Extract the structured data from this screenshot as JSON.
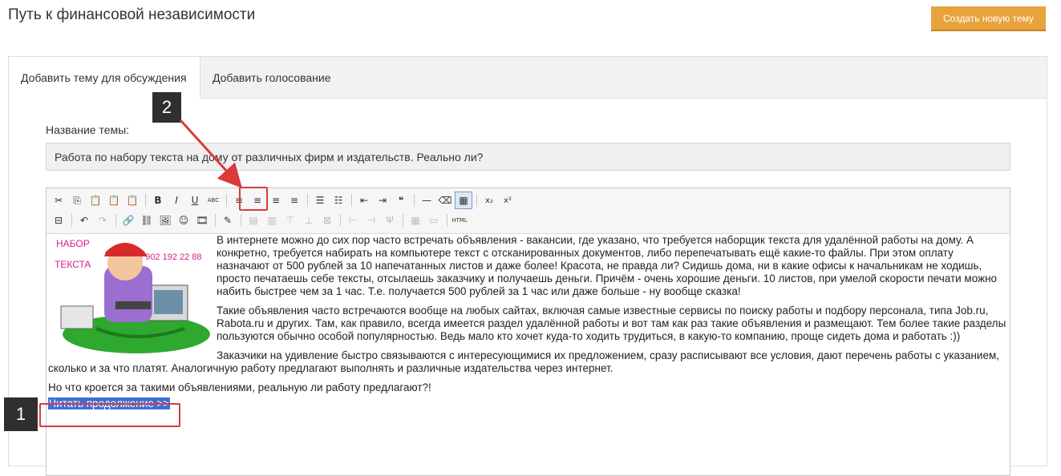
{
  "header": {
    "title": "Путь к финансовой независимости",
    "create_button": "Создать новую тему"
  },
  "tabs": [
    {
      "label": "Добавить тему для обсуждения",
      "active": true
    },
    {
      "label": "Добавить голосование",
      "active": false
    }
  ],
  "form": {
    "title_label": "Название темы:",
    "title_value": "Работа по набору текста на дому от различных фирм и издательств. Реально ли?"
  },
  "toolbar": {
    "row1": [
      {
        "icon": "cut-icon",
        "glyph": "✂"
      },
      {
        "icon": "copy-icon",
        "glyph": "⎘"
      },
      {
        "icon": "paste-icon",
        "glyph": "📋"
      },
      {
        "icon": "paste-text-icon",
        "glyph": "📋"
      },
      {
        "icon": "paste-word-icon",
        "glyph": "📋"
      },
      {
        "sep": true
      },
      {
        "icon": "bold-icon",
        "glyph": "B"
      },
      {
        "icon": "italic-icon",
        "glyph": "I"
      },
      {
        "icon": "underline-icon",
        "glyph": "U"
      },
      {
        "icon": "strikethrough-icon",
        "glyph": "ABC"
      },
      {
        "sep": true
      },
      {
        "icon": "align-left-icon",
        "glyph": "≡"
      },
      {
        "icon": "align-center-icon",
        "glyph": "≡"
      },
      {
        "icon": "align-right-icon",
        "glyph": "≡"
      },
      {
        "icon": "align-justify-icon",
        "glyph": "≡"
      },
      {
        "sep": true
      },
      {
        "icon": "bullet-list-icon",
        "glyph": "☰"
      },
      {
        "icon": "numbered-list-icon",
        "glyph": "☷"
      },
      {
        "sep": true
      },
      {
        "icon": "outdent-icon",
        "glyph": "⇤"
      },
      {
        "icon": "indent-icon",
        "glyph": "⇥"
      },
      {
        "icon": "blockquote-icon",
        "glyph": "❝"
      },
      {
        "sep": true
      },
      {
        "icon": "horizontal-rule-icon",
        "glyph": "—"
      },
      {
        "icon": "eraser-icon",
        "glyph": "⌫"
      },
      {
        "icon": "table-icon",
        "glyph": "▦"
      },
      {
        "sep": true
      },
      {
        "icon": "subscript-icon",
        "glyph": "x₂"
      },
      {
        "icon": "superscript-icon",
        "glyph": "x²"
      }
    ],
    "row2": [
      {
        "icon": "page-break-icon",
        "glyph": "⊟"
      },
      {
        "sep": true
      },
      {
        "icon": "undo-icon",
        "glyph": "↶"
      },
      {
        "icon": "redo-icon",
        "glyph": "↷"
      },
      {
        "sep": true
      },
      {
        "icon": "link-icon",
        "glyph": "🔗"
      },
      {
        "icon": "unlink-icon",
        "glyph": "⛓"
      },
      {
        "icon": "image-icon",
        "glyph": "🖼"
      },
      {
        "icon": "smiley-icon",
        "glyph": "☺"
      },
      {
        "icon": "media-icon",
        "glyph": "🎞"
      },
      {
        "sep": true
      },
      {
        "icon": "edit-icon",
        "glyph": "✎"
      },
      {
        "sep": true
      },
      {
        "icon": "table-props-icon",
        "glyph": "▤"
      },
      {
        "icon": "cell-props-icon",
        "glyph": "▥"
      },
      {
        "icon": "row-insert-before-icon",
        "glyph": "⊤"
      },
      {
        "icon": "row-insert-after-icon",
        "glyph": "⊥"
      },
      {
        "icon": "row-delete-icon",
        "glyph": "⊠"
      },
      {
        "sep": true
      },
      {
        "icon": "col-insert-before-icon",
        "glyph": "⊢"
      },
      {
        "icon": "col-insert-after-icon",
        "glyph": "⊣"
      },
      {
        "icon": "col-delete-icon",
        "glyph": "Ψ"
      },
      {
        "sep": true
      },
      {
        "icon": "split-cells-icon",
        "glyph": "▦"
      },
      {
        "icon": "merge-cells-icon",
        "glyph": "▭"
      },
      {
        "sep": true
      },
      {
        "icon": "html-icon",
        "glyph": "HTML"
      }
    ]
  },
  "content": {
    "image_text_1": "НАБОР",
    "image_text_2": "ТЕКСТА",
    "image_phone": "8 902 192 22 88",
    "paragraphs": [
      "В интернете можно до сих пор часто встречать объявления - вакансии, где указано, что требуется наборщик текста для удалённой работы на дому. А конкретно, требуется набирать на компьютере текст с отсканированных документов, либо перепечатывать ещё какие-то файлы. При этом оплату назначают от 500 рублей за 10 напечатанных листов и даже более! Красота, не правда ли? Сидишь дома, ни в какие офисы к начальникам не ходишь, просто печатаешь себе тексты, отсылаешь заказчику и получаешь деньги. Причём - очень хорошие деньги. 10 листов, при умелой скорости печати можно набить быстрее чем за 1 час. Т.е. получается 500 рублей за 1 час или даже больше - ну вообще сказка!",
      "Такие объявления часто встречаются вообще на любых сайтах, включая самые известные сервисы по поиску работы и подбору персонала, типа Job.ru, Rabota.ru и других. Там, как правило, всегда имеется раздел удалённой работы и вот там как раз такие объявления и размещают. Тем более такие разделы пользуются обычно особой популярностью. Ведь мало кто хочет куда-то ходить трудиться, в какую-то компанию, проще сидеть дома и работать :))",
      "Заказчики на удивление быстро связываются с интересующимися их предложением, сразу расписывают все условия, дают перечень работы с указанием, сколько и за что платят. Аналогичную работу предлагают выполнять и различные издательства через интернет.",
      "Но что кроется за такими объявлениями, реальную ли работу предлагают?!"
    ],
    "read_more": "Читать продолжение >>"
  },
  "annotations": {
    "callout_1": "1",
    "callout_2": "2"
  },
  "colors": {
    "accent": "#e8a33c",
    "highlight": "#d93b3b",
    "selection": "#3d6fd8"
  }
}
